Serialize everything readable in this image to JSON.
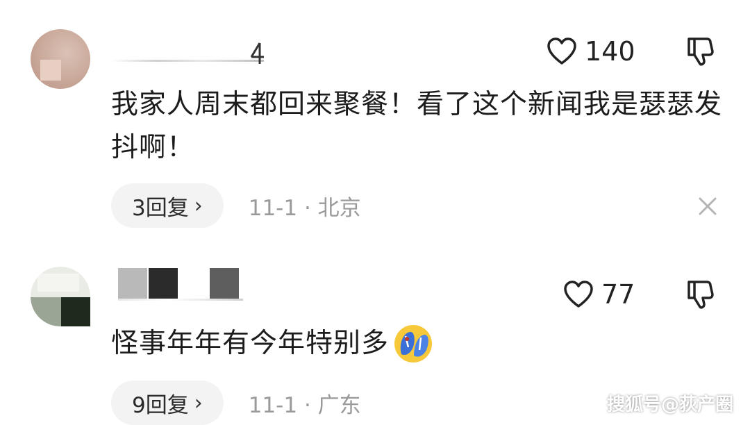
{
  "comments": [
    {
      "like_count": "140",
      "text": "我家人周末都回来聚餐！看了这个新闻我是瑟瑟发抖啊！",
      "reply_label": "3回复",
      "date_location": "11-1 · 北京",
      "icons": {
        "like": "heart-icon",
        "dislike": "thumb-down-icon",
        "dismiss": "close-icon"
      }
    },
    {
      "like_count": "77",
      "text": "怪事年年有今年特别多",
      "reply_label": "9回复",
      "date_location": "11-1 · 广东",
      "icons": {
        "like": "heart-icon",
        "dislike": "thumb-down-icon",
        "emoji": "flip-flop-emoji"
      }
    }
  ],
  "watermark": "搜狐号@荻产圈",
  "colors": {
    "text": "#1c1c1c",
    "meta": "#9a9a9a",
    "pill_bg": "#f3f3f3"
  }
}
